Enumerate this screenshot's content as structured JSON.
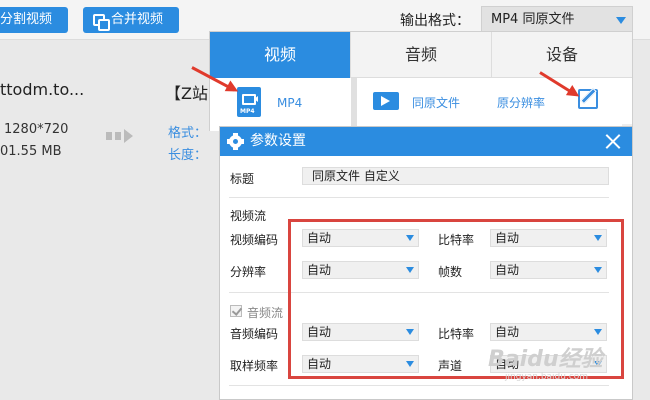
{
  "toolbar": {
    "split_label": "分割视频",
    "merge_label": "合并视频",
    "output_format_label": "输出格式：",
    "output_format_value": "MP4  同原文件"
  },
  "file": {
    "name": "ttodm.to...",
    "resolution": "1280*720",
    "size": "01.55 MB",
    "target_name": "【Z站",
    "target_key1": "格式：",
    "target_key2": "长度："
  },
  "format_panel": {
    "tabs": [
      {
        "label": "视频",
        "active": true
      },
      {
        "label": "音频",
        "active": false
      },
      {
        "label": "设备",
        "active": false
      }
    ],
    "selected_format": "MP4",
    "option_same": "同原文件",
    "option_resolution": "原分辨率"
  },
  "dialog": {
    "title": "参数设置",
    "title_field_label": "标题",
    "title_field_value": "同原文件 自定义",
    "video_section": "视频流",
    "video_codec_label": "视频编码",
    "video_codec_value": "自动",
    "video_bitrate_label": "比特率",
    "video_bitrate_value": "自动",
    "resolution_label": "分辨率",
    "resolution_value": "自动",
    "fps_label": "帧数",
    "fps_value": "自动",
    "audio_section": "音频流",
    "audio_codec_label": "音频编码",
    "audio_codec_value": "自动",
    "audio_bitrate_label": "比特率",
    "audio_bitrate_value": "自动",
    "sample_rate_label": "取样频率",
    "sample_rate_value": "自动",
    "channel_label": "声道",
    "channel_value": "自动"
  },
  "watermark": "Baidu经验",
  "watermark_url": "jingyan.baidu.com",
  "colors": {
    "accent": "#2b8ce0",
    "highlight": "#d9453f",
    "arrow": "#e03a2c"
  }
}
